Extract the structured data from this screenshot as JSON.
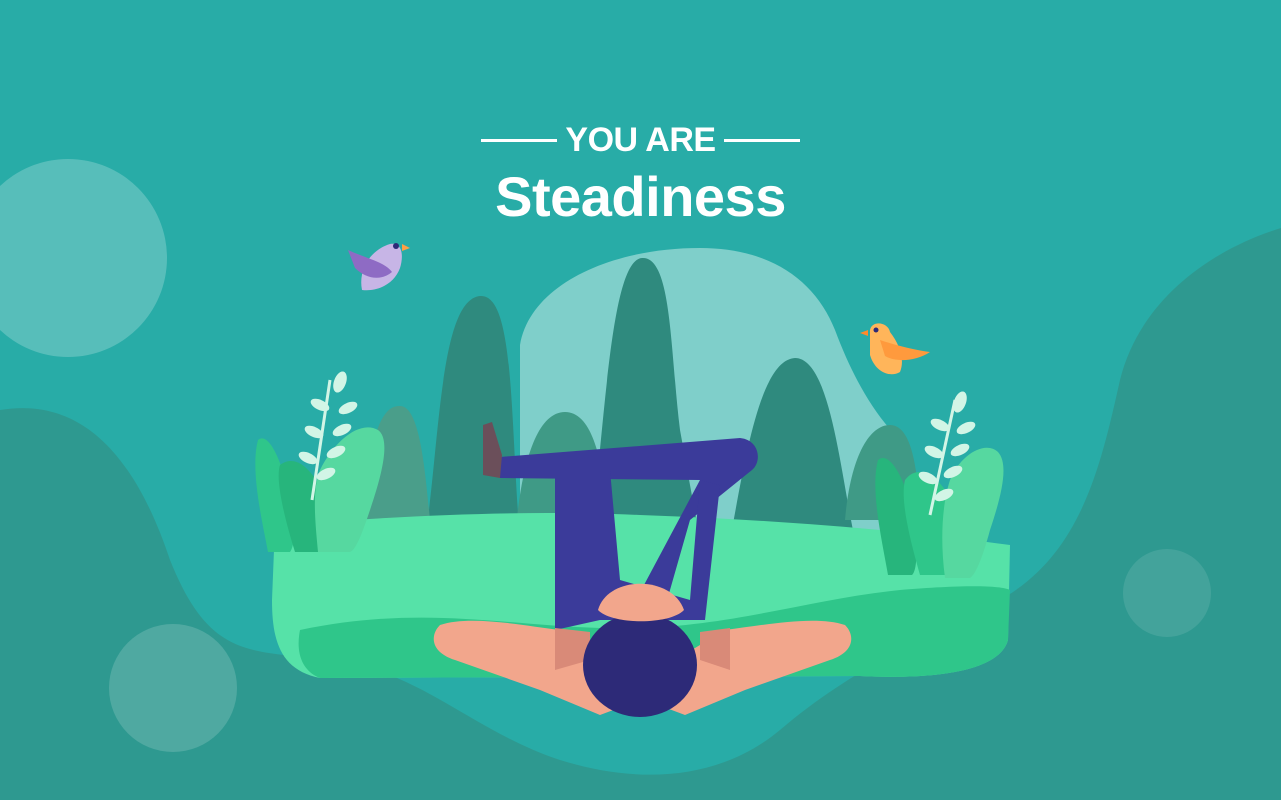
{
  "banner": {
    "kicker": "YOU ARE",
    "headline": "Steadiness"
  },
  "illustration": {
    "subject": "person-lying-leg-stretch",
    "decor": [
      "left-bird",
      "right-bird",
      "left-fern",
      "right-fern",
      "mountains"
    ]
  },
  "colors": {
    "background": "#28aca7",
    "background_dark": "#2e9990",
    "sky_blob": "#7fcfca",
    "mountain": "#2f8a7e",
    "grass_light": "#56e2a8",
    "grass_dark": "#2fc68a",
    "pants": "#3b3b9a",
    "skin": "#f2a68c",
    "hair": "#2d2a78",
    "bird_purple": "#b39ddb",
    "bird_orange": "#ffb55a"
  }
}
